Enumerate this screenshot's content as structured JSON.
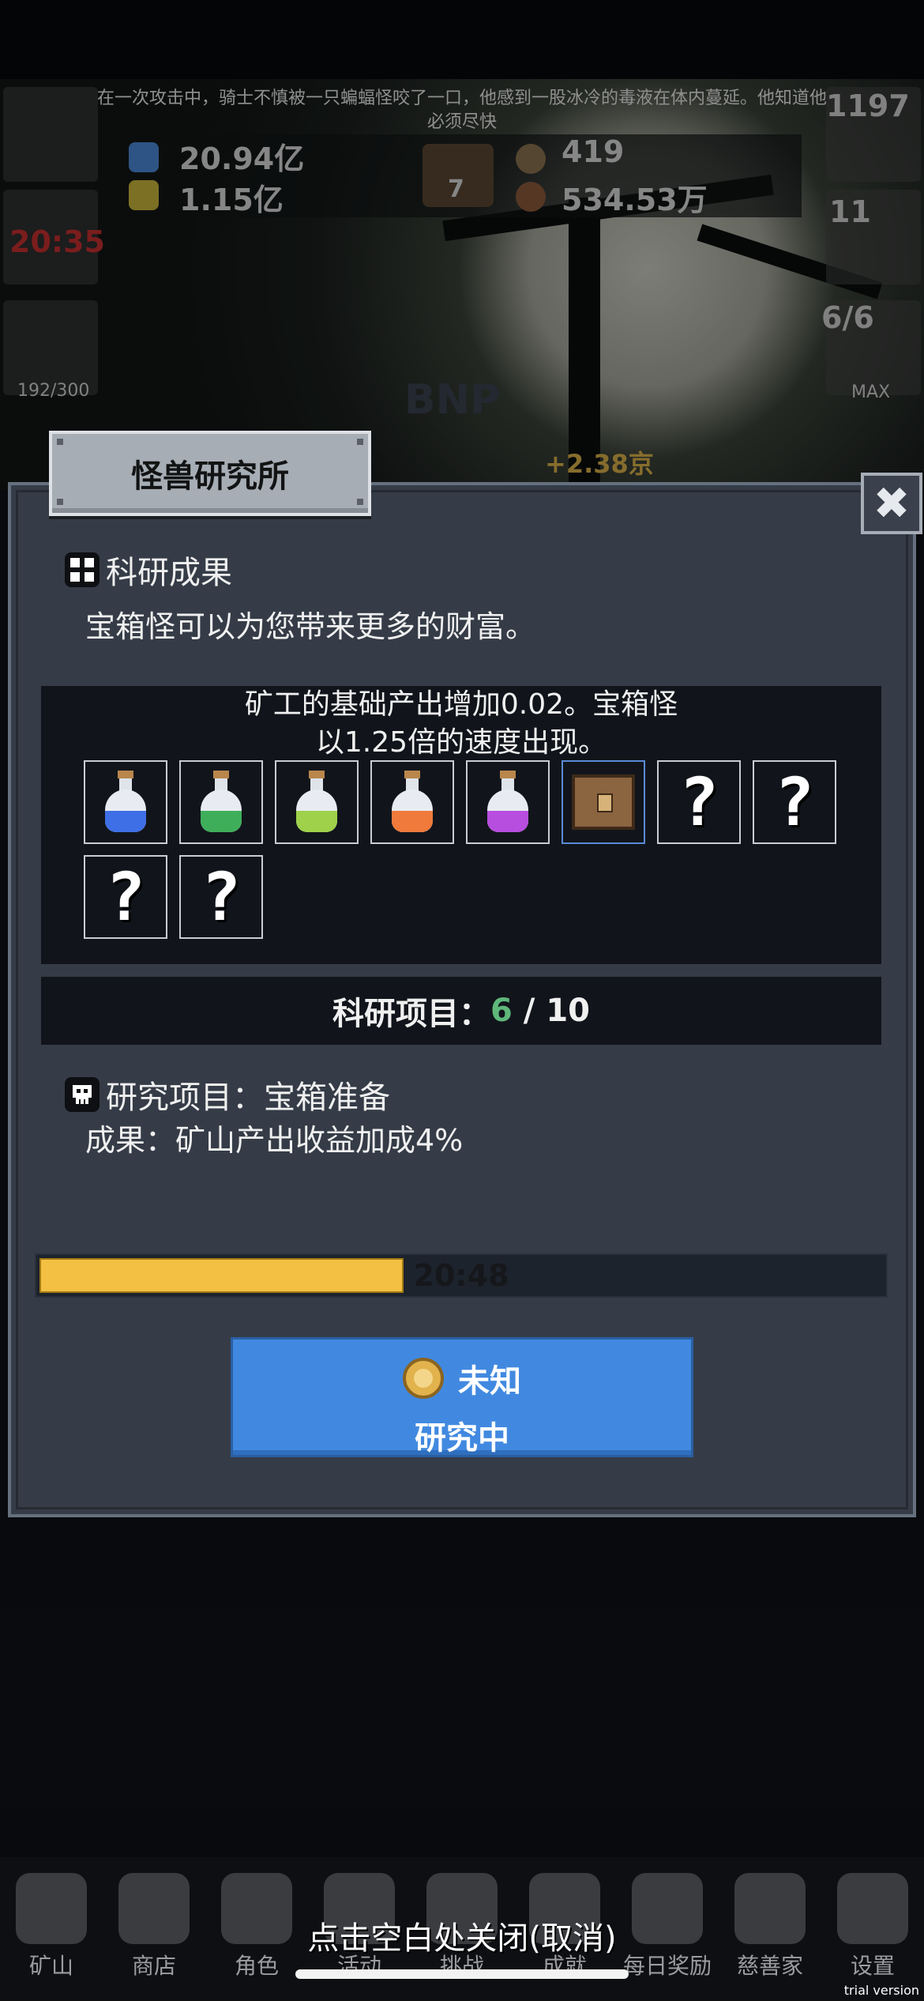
{
  "background": {
    "story_text": "在一次攻击中，骑士不慎被一只蝙蝠怪咬了一口，他感到一股冰冷的毒液在体内蔓延。他知道他必须尽快",
    "resources": {
      "blue_potion": "20.94亿",
      "yellow_potion": "1.15亿",
      "book_count": "7",
      "coin": "419",
      "meat": "534.53万"
    },
    "side_left": {
      "timer": "20:35",
      "capacity": "192/300"
    },
    "side_right": {
      "potion_count": "1197",
      "chest_count": "11",
      "tree_count": "6/6",
      "max_label": "MAX"
    },
    "income_bonus": "+2.38京",
    "faint_label": "BNP"
  },
  "panel": {
    "title": "怪兽研究所",
    "close_label": "✖",
    "results": {
      "heading": "科研成果",
      "text": "宝箱怪可以为您带来更多的财富。"
    },
    "detail": {
      "line1": "矿工的基础产出增加0.02。宝箱怪",
      "line2": "以1.25倍的速度出现。"
    },
    "slots": [
      {
        "kind": "flask",
        "color": "#3e6fe6",
        "icon": "blue-potion-icon"
      },
      {
        "kind": "flask",
        "color": "#3fae5a",
        "icon": "green-potion-icon"
      },
      {
        "kind": "flask",
        "color": "#9fd14a",
        "icon": "lime-potion-icon"
      },
      {
        "kind": "flask",
        "color": "#ef7a3b",
        "icon": "orange-potion-icon"
      },
      {
        "kind": "flask",
        "color": "#b84ee0",
        "icon": "purple-potion-icon"
      },
      {
        "kind": "chest",
        "selected": true,
        "icon": "treasure-chest-icon"
      },
      {
        "kind": "unknown",
        "label": "?",
        "icon": "question-mark-icon"
      },
      {
        "kind": "unknown",
        "label": "?",
        "icon": "question-mark-icon"
      },
      {
        "kind": "unknown",
        "label": "?",
        "icon": "question-mark-icon"
      },
      {
        "kind": "unknown",
        "label": "?",
        "icon": "question-mark-icon"
      }
    ],
    "count": {
      "label": "科研项目：",
      "current": "6",
      "sep": " / ",
      "total": "10"
    },
    "project": {
      "heading": "研究项目：宝箱准备",
      "result": "成果：矿山产出收益加成4%"
    },
    "progress": {
      "value": 0.43,
      "time": "20:48"
    },
    "button": {
      "cost": "未知",
      "status": "研究中"
    }
  },
  "nav": {
    "items": [
      "矿山",
      "商店",
      "角色",
      "活动",
      "挑战",
      "成就",
      "每日奖励",
      "慈善家",
      "设置"
    ]
  },
  "close_hint": "点击空白处关闭(取消)",
  "watermark": "trial version",
  "colors": {
    "accent_blue": "#4189e0",
    "progress_yellow": "#f3c043",
    "count_green": "#5fb77a"
  }
}
